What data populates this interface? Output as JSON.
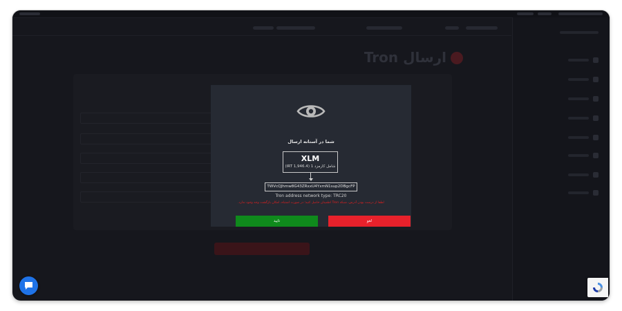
{
  "page": {
    "title": "ارسال Tron"
  },
  "modal": {
    "title": "شما در آستانه ارسال",
    "coin_symbol": "XLM",
    "fee_text": "شامل کارمزد 1 (IRT 1,946.4)",
    "address": "TWVcQJhmw8G43ZRxxU4YxmN1sup2DBgcFP",
    "network_text": "Tron address network type: TRC20",
    "warning_text": "لطفا از درست بودن آدرس، شبکه Tron اطمینان حاصل کنید؛ در صورت اشتباه، امکان بازگشت وجه وجود ندارد.",
    "confirm_label": "تایید",
    "cancel_label": "لغو"
  },
  "icons": {
    "eye": "eye-icon",
    "chat": "chat-icon",
    "recaptcha": "recaptcha-icon"
  },
  "colors": {
    "confirm": "#0f8a1c",
    "cancel": "#e8212b",
    "warning": "#e02020",
    "chat": "#1f73e8"
  }
}
